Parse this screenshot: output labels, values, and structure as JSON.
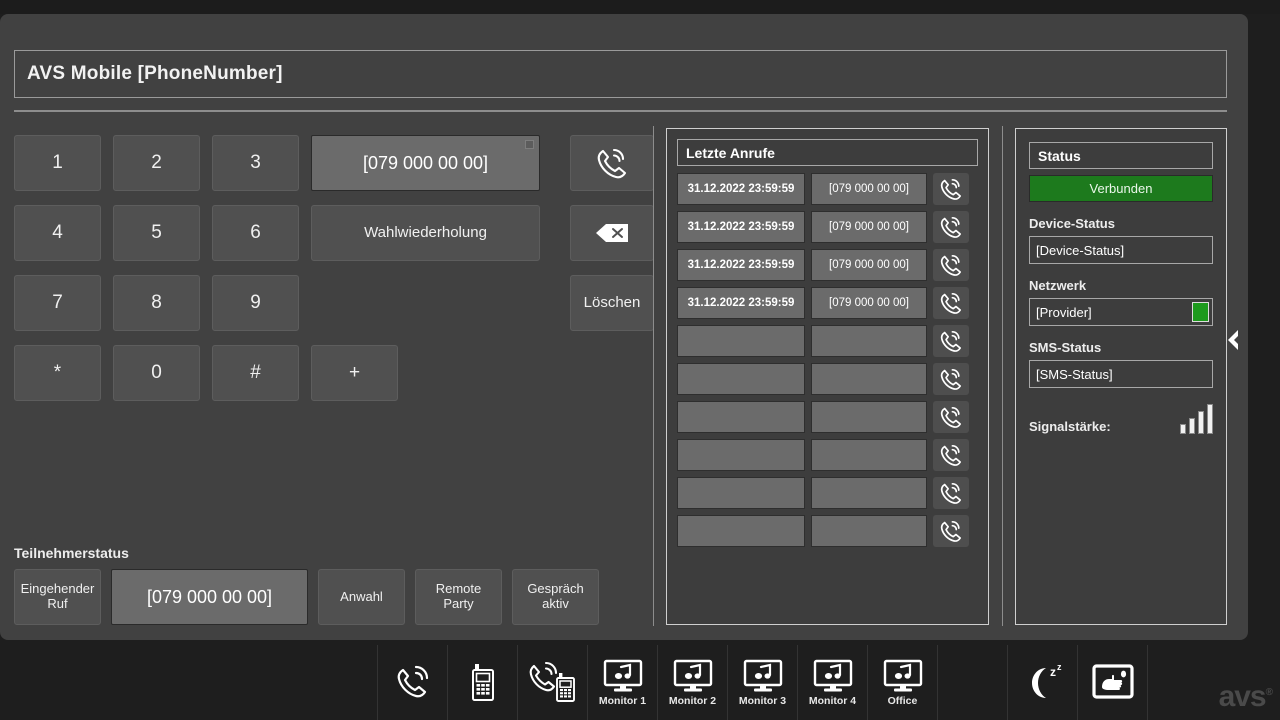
{
  "window": {
    "title": "AVS Mobile [PhoneNumber]"
  },
  "keypad": {
    "keys": [
      "1",
      "2",
      "3",
      "4",
      "5",
      "6",
      "7",
      "8",
      "9",
      "*",
      "0",
      "#",
      "+"
    ],
    "display_value": "[079 000 00 00]",
    "redial_label": "Wahlwiederholung",
    "call_icon": "phone-handset-icon",
    "backspace_icon": "backspace-icon",
    "delete_label": "Löschen"
  },
  "subscriber": {
    "section_label": "Teilnehmerstatus",
    "incoming_label": "Eingehender Ruf",
    "number_value": "[079 000 00 00]",
    "dialing_label": "Anwahl",
    "remote_party_label": "Remote Party",
    "call_active_label": "Gespräch aktiv"
  },
  "calls": {
    "header": "Letzte Anrufe",
    "dial_icon": "phone-handset-icon",
    "rows": [
      {
        "time": "31.12.2022 23:59:59",
        "number": "[079 000 00 00]"
      },
      {
        "time": "31.12.2022 23:59:59",
        "number": "[079 000 00 00]"
      },
      {
        "time": "31.12.2022 23:59:59",
        "number": "[079 000 00 00]"
      },
      {
        "time": "31.12.2022 23:59:59",
        "number": "[079 000 00 00]"
      },
      {
        "time": "",
        "number": ""
      },
      {
        "time": "",
        "number": ""
      },
      {
        "time": "",
        "number": ""
      },
      {
        "time": "",
        "number": ""
      },
      {
        "time": "",
        "number": ""
      },
      {
        "time": "",
        "number": ""
      }
    ]
  },
  "status": {
    "header": "Status",
    "connection_state": "Verbunden",
    "connection_color": "#1d7a1d",
    "device_status_label": "Device-Status",
    "device_status_value": "[Device-Status]",
    "network_label": "Netzwerk",
    "network_value": "[Provider]",
    "network_indicator_color": "#1d9a1d",
    "sms_status_label": "SMS-Status",
    "sms_status_value": "[SMS-Status]",
    "signal_label": "Signalstärke:",
    "signal_bars": 4,
    "signal_bars_total": 4
  },
  "edge": {
    "collapse_icon": "chevron-left-icon"
  },
  "taskbar": {
    "items": [
      {
        "icon": "phone-ringing-icon",
        "label": ""
      },
      {
        "icon": "handset-radio-icon",
        "label": ""
      },
      {
        "icon": "phone-radio-call-icon",
        "label": ""
      },
      {
        "icon": "monitor-audio-icon",
        "label": "Monitor 1"
      },
      {
        "icon": "monitor-audio-icon",
        "label": "Monitor 2"
      },
      {
        "icon": "monitor-audio-icon",
        "label": "Monitor 3"
      },
      {
        "icon": "monitor-audio-icon",
        "label": "Monitor 4"
      },
      {
        "icon": "monitor-audio-icon",
        "label": "Office"
      }
    ],
    "night_mode_icon": "moon-sleep-icon",
    "hand_wash_icon": "hand-hygiene-icon",
    "logo": "avs",
    "logo_mark": "®"
  }
}
